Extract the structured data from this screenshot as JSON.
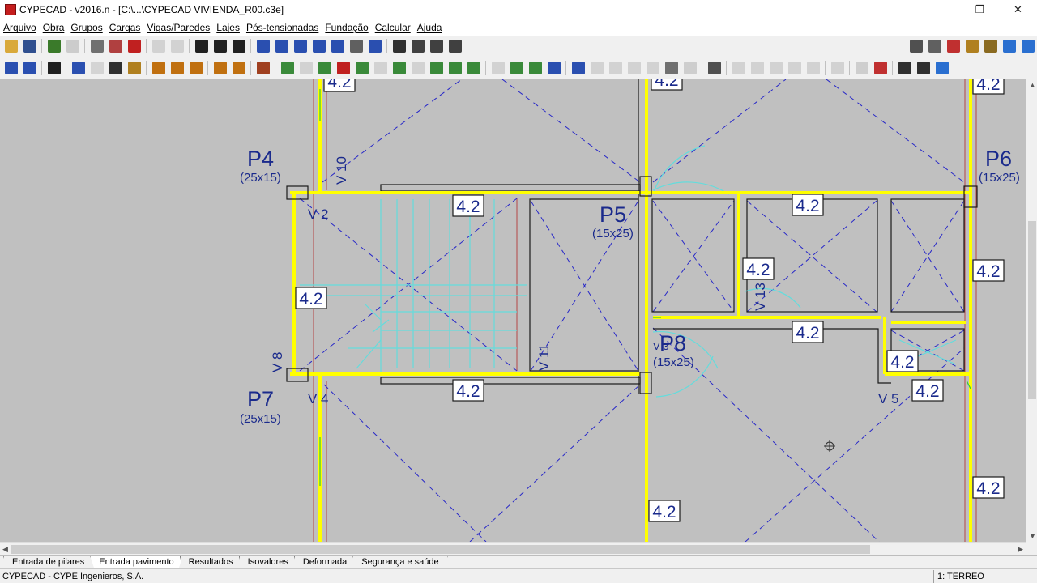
{
  "window": {
    "title": "CYPECAD - v2016.n - [C:\\...\\CYPECAD VIVIENDA_R00.c3e]",
    "minimize": "–",
    "maximize": "❐",
    "close": "✕"
  },
  "menu": [
    "Arquivo",
    "Obra",
    "Grupos",
    "Cargas",
    "Vigas/Paredes",
    "Lajes",
    "Pós-tensionadas",
    "Fundação",
    "Calcular",
    "Ajuda"
  ],
  "toolbar1": [
    {
      "icon": "open-folder-icon",
      "color": "#d9a93a"
    },
    {
      "icon": "save-icon",
      "color": "#2f4f8f"
    },
    {
      "sep": true
    },
    {
      "icon": "edit-pillar-icon",
      "color": "#3a7a2a"
    },
    {
      "icon": "pillar-gray-icon",
      "color": "#8a8a8a",
      "disabled": true
    },
    {
      "sep": true
    },
    {
      "icon": "dxf-icon",
      "color": "#707070"
    },
    {
      "icon": "grid-icon",
      "color": "#b04040"
    },
    {
      "icon": "magnet-icon",
      "color": "#c02020"
    },
    {
      "sep": true
    },
    {
      "icon": "undo-icon",
      "color": "#9a9a9a",
      "disabled": true
    },
    {
      "icon": "redo-icon",
      "color": "#9a9a9a",
      "disabled": true
    },
    {
      "sep": true
    },
    {
      "icon": "level-up-icon",
      "color": "#202020"
    },
    {
      "icon": "level-select-icon",
      "color": "#202020"
    },
    {
      "icon": "level-down-icon",
      "color": "#202020"
    },
    {
      "sep": true
    },
    {
      "icon": "zoom-window-icon",
      "color": "#2a4fb0"
    },
    {
      "icon": "zoom-all-icon",
      "color": "#2a4fb0"
    },
    {
      "icon": "zoom-in-icon",
      "color": "#2a4fb0"
    },
    {
      "icon": "regen-icon",
      "color": "#2a4fb0"
    },
    {
      "icon": "zoom-out-icon",
      "color": "#2a4fb0"
    },
    {
      "icon": "pan-hand-icon",
      "color": "#606060"
    },
    {
      "icon": "redraw-icon",
      "color": "#2a4fb0"
    },
    {
      "sep": true
    },
    {
      "icon": "text-view-icon",
      "color": "#303030"
    },
    {
      "icon": "snap-icon",
      "color": "#404040"
    },
    {
      "icon": "ortho-icon",
      "color": "#404040"
    },
    {
      "icon": "measure-icon",
      "color": "#404040"
    }
  ],
  "toolbar1_right": [
    {
      "icon": "print-icon",
      "color": "#505050"
    },
    {
      "icon": "print-setup-icon",
      "color": "#606060"
    },
    {
      "icon": "export-icon",
      "color": "#c03030"
    },
    {
      "icon": "structure-3d-icon",
      "color": "#b08020"
    },
    {
      "icon": "views-icon",
      "color": "#8a6a20"
    },
    {
      "icon": "help-icon",
      "color": "#2a6fd0"
    },
    {
      "icon": "web-icon",
      "color": "#2a6fd0"
    }
  ],
  "toolbar2": [
    {
      "icon": "floors-icon",
      "color": "#2a4fb0"
    },
    {
      "icon": "groups-icon",
      "color": "#2a4fb0"
    },
    {
      "sep": true
    },
    {
      "icon": "stairs-icon",
      "color": "#202020"
    },
    {
      "sep": true
    },
    {
      "icon": "wall-grid-icon",
      "color": "#2a4fb0"
    },
    {
      "icon": "fire-drop-icon",
      "color": "#a0a0a0",
      "disabled": true
    },
    {
      "icon": "pillar-panel-icon",
      "color": "#303030"
    },
    {
      "icon": "box-icon",
      "color": "#b08020"
    },
    {
      "sep": true
    },
    {
      "icon": "beam-1-icon",
      "color": "#c07010"
    },
    {
      "icon": "beam-2-icon",
      "color": "#c07010"
    },
    {
      "icon": "beam-3-icon",
      "color": "#c07010"
    },
    {
      "sep": true
    },
    {
      "icon": "beam-edit-icon",
      "color": "#c07010"
    },
    {
      "icon": "beam-info-icon",
      "color": "#c07010"
    },
    {
      "sep": true
    },
    {
      "icon": "wall-icon",
      "color": "#a04020"
    },
    {
      "sep": true
    },
    {
      "icon": "slab-new-icon",
      "color": "#3a8a3a"
    },
    {
      "icon": "slab-gray-icon",
      "color": "#9a9a9a",
      "disabled": true
    },
    {
      "icon": "slab-edit-icon",
      "color": "#3a8a3a"
    },
    {
      "icon": "slab-delete-icon",
      "color": "#c02020"
    },
    {
      "icon": "slab-move-icon",
      "color": "#3a8a3a"
    },
    {
      "icon": "slab-gray2-icon",
      "color": "#9a9a9a",
      "disabled": true
    },
    {
      "icon": "slab-copy-icon",
      "color": "#3a8a3a"
    },
    {
      "icon": "slab-gray3-icon",
      "color": "#9a9a9a",
      "disabled": true
    },
    {
      "icon": "slab-join-icon",
      "color": "#3a8a3a"
    },
    {
      "icon": "slab-align-icon",
      "color": "#3a8a3a"
    },
    {
      "icon": "slab-cut-icon",
      "color": "#3a8a3a"
    },
    {
      "sep": true
    },
    {
      "icon": "rib-gray-icon",
      "color": "#9a9a9a",
      "disabled": true
    },
    {
      "icon": "rib-new-icon",
      "color": "#3a8a3a"
    },
    {
      "icon": "rib-edit-icon",
      "color": "#3a8a3a"
    },
    {
      "icon": "rib-delete-icon",
      "color": "#2a4fb0"
    },
    {
      "sep": true
    },
    {
      "icon": "loads-icon",
      "color": "#2a4fb0"
    },
    {
      "icon": "load-gray1-icon",
      "color": "#9a9a9a",
      "disabled": true
    },
    {
      "icon": "load-gray2-icon",
      "color": "#9a9a9a",
      "disabled": true
    },
    {
      "icon": "load-gray3-icon",
      "color": "#9a9a9a",
      "disabled": true
    },
    {
      "icon": "load-gray4-icon",
      "color": "#9a9a9a",
      "disabled": true
    },
    {
      "icon": "load-view-icon",
      "color": "#707070"
    },
    {
      "icon": "load-x-icon",
      "color": "#909090",
      "disabled": true
    },
    {
      "sep": true
    },
    {
      "icon": "reinforce-icon",
      "color": "#505050"
    },
    {
      "sep": true
    },
    {
      "icon": "res-gray1-icon",
      "color": "#9a9a9a",
      "disabled": true
    },
    {
      "icon": "res-gray2-icon",
      "color": "#9a9a9a",
      "disabled": true
    },
    {
      "icon": "res-gray3-icon",
      "color": "#9a9a9a",
      "disabled": true
    },
    {
      "icon": "res-gray4-icon",
      "color": "#9a9a9a",
      "disabled": true
    },
    {
      "icon": "res-gray5-icon",
      "color": "#9a9a9a",
      "disabled": true
    },
    {
      "sep": true
    },
    {
      "icon": "res-gray6-icon",
      "color": "#9a9a9a",
      "disabled": true
    },
    {
      "sep": true
    },
    {
      "icon": "eye-icon",
      "color": "#909090",
      "disabled": true
    },
    {
      "icon": "table-red-icon",
      "color": "#c03030"
    },
    {
      "sep": true
    },
    {
      "icon": "pick-icon",
      "color": "#303030"
    },
    {
      "icon": "pick-edit-icon",
      "color": "#303030"
    },
    {
      "icon": "info-icon",
      "color": "#2a6fd0"
    }
  ],
  "drawing": {
    "pillars": [
      {
        "name": "P4",
        "size": "(25x15)"
      },
      {
        "name": "P5",
        "size": "(15x25)"
      },
      {
        "name": "P6",
        "size": "(15x25)"
      },
      {
        "name": "P7",
        "size": "(25x15)"
      },
      {
        "name": "P8",
        "size": "(15x25)"
      }
    ],
    "beams": [
      "V 10",
      "V 2",
      "V 8",
      "V 11",
      "V 4",
      "V 5",
      "V 13",
      "V 3"
    ],
    "load_label": "4.2",
    "colors": {
      "background": "#c0c0c0",
      "beam": "#ffff00",
      "beam_inner": "#32c832",
      "outline": "#1a1a1a",
      "panel_line": "#2828c8",
      "stair": "#64dcdc",
      "pillar_text": "#1a2a8c",
      "wall_edge": "#b44646"
    }
  },
  "tabs": [
    "Entrada de pilares",
    "Entrada pavimento",
    "Resultados",
    "Isovalores",
    "Deformada",
    "Segurança e saúde"
  ],
  "active_tab": "Entrada pavimento",
  "status": {
    "left": "CYPECAD - CYPE Ingenieros, S.A.",
    "right": "1: TERREO"
  }
}
